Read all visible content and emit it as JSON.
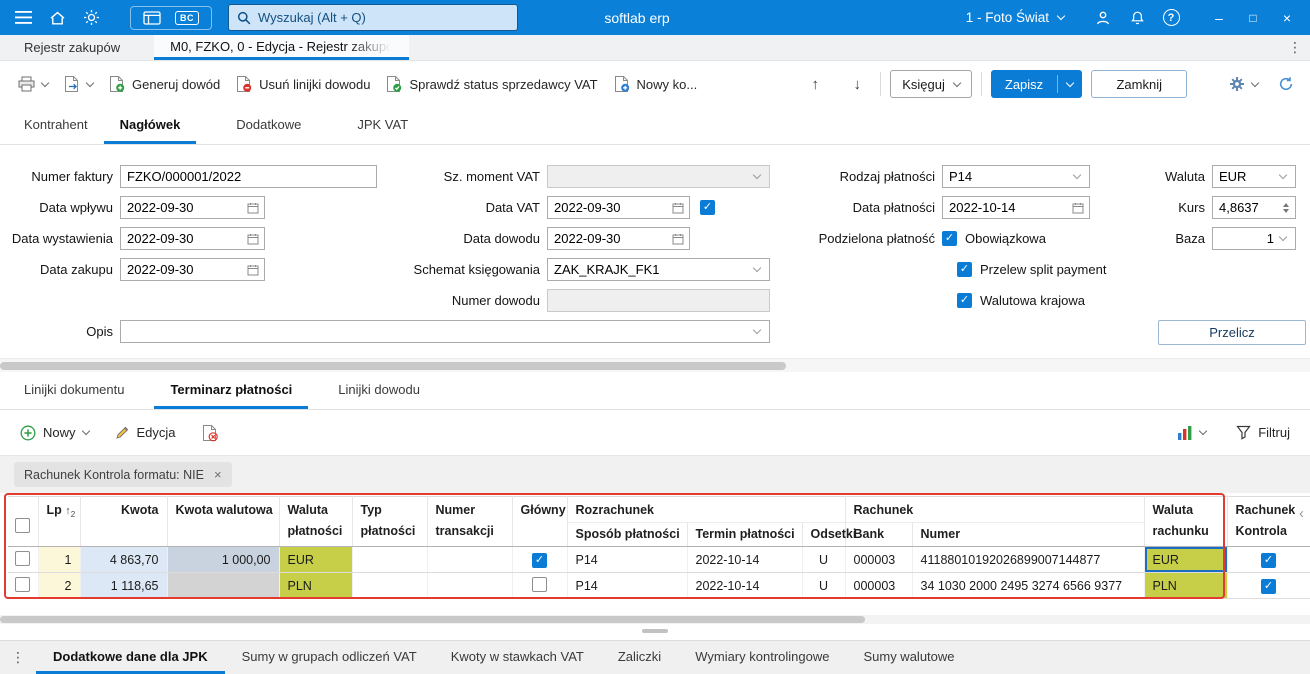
{
  "colors": {
    "topbar": "#0b80d8",
    "accent": "#0a7cd6",
    "red_frame": "#e23c30",
    "cell_lp": "#fcf7d8",
    "cell_amount": "#dce8f5",
    "cell_amount_fx": "#c8d3df",
    "cell_amount_fx_empty": "#d3d3d3",
    "cell_currency": "#c7cf48"
  },
  "icons": {
    "arrow_up": "↑",
    "arrow_down": "↓",
    "dots_vertical": "⋮",
    "minimize": "–",
    "maximize": "□",
    "close": "×",
    "help": "?",
    "bc_badge": "BC",
    "chip_close": "×",
    "scroll_left": "‹"
  },
  "topbar": {
    "search_placeholder": "Wyszukaj (Alt + Q)",
    "app_name": "softlab erp",
    "company_selector": "1 - Foto Świat"
  },
  "window_tabs": {
    "inactive": "Rejestr zakupów",
    "active": "M0, FZKO, 0 - Edycja - Rejestr zakupó"
  },
  "toolbar": {
    "generate_doc": "Generuj dowód",
    "delete_doc_lines": "Usuń linijki dowodu",
    "check_vat_status": "Sprawdź status sprzedawcy VAT",
    "new_contractor": "Nowy ko...",
    "post_label": "Księguj",
    "save_label": "Zapisz",
    "close_label": "Zamknij"
  },
  "form_tabs": {
    "kontrahent": "Kontrahent",
    "naglowek": "Nagłówek",
    "dodatkowe": "Dodatkowe",
    "jpk_vat": "JPK VAT"
  },
  "form": {
    "numer_faktury": {
      "label": "Numer faktury",
      "value": "FZKO/000001/2022"
    },
    "data_wplywu": {
      "label": "Data wpływu",
      "value": "2022-09-30"
    },
    "data_wystawienia": {
      "label": "Data wystawienia",
      "value": "2022-09-30"
    },
    "data_zakupu": {
      "label": "Data zakupu",
      "value": "2022-09-30"
    },
    "sz_moment_vat": {
      "label": "Sz. moment VAT",
      "value": ""
    },
    "data_vat": {
      "label": "Data VAT",
      "value": "2022-09-30",
      "checked": true
    },
    "data_dowodu": {
      "label": "Data dowodu",
      "value": "2022-09-30"
    },
    "schemat_ksiegowania": {
      "label": "Schemat księgowania",
      "value": "ZAK_KRAJK_FK1"
    },
    "numer_dowodu": {
      "label": "Numer dowodu",
      "value": ""
    },
    "opis": {
      "label": "Opis",
      "value": ""
    },
    "rodzaj_platnosci": {
      "label": "Rodzaj płatności",
      "value": "P14"
    },
    "data_platnosci": {
      "label": "Data płatności",
      "value": "2022-10-14"
    },
    "podzielona_platnosc": {
      "label": "Podzielona płatność",
      "option": "Obowiązkowa",
      "checked": true
    },
    "przelew_split": {
      "label": "Przelew split payment",
      "checked": true
    },
    "walutowa_krajowa": {
      "label": "Walutowa krajowa",
      "checked": true
    },
    "waluta": {
      "label": "Waluta",
      "value": "EUR"
    },
    "kurs": {
      "label": "Kurs",
      "value": "4,8637"
    },
    "baza": {
      "label": "Baza",
      "value": "1"
    },
    "przelicz_label": "Przelicz"
  },
  "detail_tabs": {
    "linijki_dokumentu": "Linijki dokumentu",
    "terminarz_platnosci": "Terminarz płatności",
    "linijki_dowodu": "Linijki dowodu"
  },
  "grid_toolbar": {
    "new_label": "Nowy",
    "edit_label": "Edycja",
    "filter_label": "Filtruj"
  },
  "filter_chip": {
    "label": "Rachunek Kontrola formatu: NIE"
  },
  "grid": {
    "headers": {
      "lp": "Lp",
      "sort_arrow": "↑",
      "sort_order": "2",
      "kwota": "Kwota",
      "kwota_walutowa": "Kwota walutowa",
      "waluta_platnosci": "Waluta płatności",
      "typ_platnosci": "Typ płatności",
      "numer_transakcji": "Numer transakcji",
      "glowny": "Główny",
      "rozrachunek": "Rozrachunek",
      "sposob_platnosci": "Sposób płatności",
      "termin_platnosci": "Termin płatności",
      "odsetki": "Odsetki",
      "rachunek": "Rachunek",
      "bank": "Bank",
      "numer": "Numer",
      "waluta_rachunku": "Waluta rachunku",
      "rachunek_kontrola": "Rachunek Kontrola"
    },
    "rows": [
      {
        "lp": "1",
        "kwota": "4 863,70",
        "kwota_walutowa": "1 000,00",
        "waluta_platnosci": "EUR",
        "typ_platnosci": "",
        "numer_transakcji": "",
        "glowny": true,
        "sposob_platnosci": "P14",
        "termin_platnosci": "2022-10-14",
        "odsetki": "U",
        "bank": "000003",
        "numer": "41188010192026899007144877",
        "waluta_rachunku": "EUR",
        "kontrola": true
      },
      {
        "lp": "2",
        "kwota": "1 118,65",
        "kwota_walutowa": "",
        "waluta_platnosci": "PLN",
        "typ_platnosci": "",
        "numer_transakcji": "",
        "glowny": false,
        "sposob_platnosci": "P14",
        "termin_platnosci": "2022-10-14",
        "odsetki": "U",
        "bank": "000003",
        "numer": "34 1030 2000 2495 3274 6566 9377",
        "waluta_rachunku": "PLN",
        "kontrola": true
      }
    ]
  },
  "bottom_tabs": {
    "jpk": "Dodatkowe dane dla JPK",
    "sumy_grupy": "Sumy w grupach odliczeń VAT",
    "kwoty_stawki": "Kwoty w stawkach VAT",
    "zaliczki": "Zaliczki",
    "wymiary": "Wymiary kontrolingowe",
    "sumy_walutowe": "Sumy walutowe"
  }
}
